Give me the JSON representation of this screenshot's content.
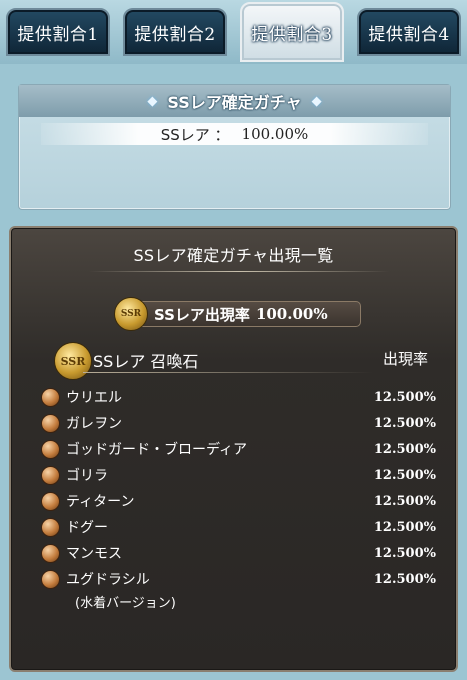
{
  "tabs": [
    {
      "label": "提供割合1"
    },
    {
      "label": "提供割合2"
    },
    {
      "label": "提供割合3"
    },
    {
      "label": "提供割合4"
    }
  ],
  "summary": {
    "title": "SSレア確定ガチャ",
    "rarity_label": "SSレア ：",
    "rarity_rate": "100.00%"
  },
  "list": {
    "title": "SSレア確定ガチャ出現一覧",
    "ssr_rate_label": "SSレア出現率",
    "ssr_rate_value": "100.00%",
    "badge_text": "SSR",
    "category_label": "SSレア 召喚石",
    "rate_column_label": "出現率",
    "items": [
      {
        "name": "ウリエル",
        "rate": "12.500%"
      },
      {
        "name": "ガレヲン",
        "rate": "12.500%"
      },
      {
        "name": "ゴッドガード・ブローディア",
        "rate": "12.500%"
      },
      {
        "name": "ゴリラ",
        "rate": "12.500%"
      },
      {
        "name": "ティターン",
        "rate": "12.500%"
      },
      {
        "name": "ドグー",
        "rate": "12.500%"
      },
      {
        "name": "マンモス",
        "rate": "12.500%"
      },
      {
        "name": "ユグドラシル",
        "rate": "12.500%",
        "sub": "(水着バージョン)"
      }
    ]
  }
}
